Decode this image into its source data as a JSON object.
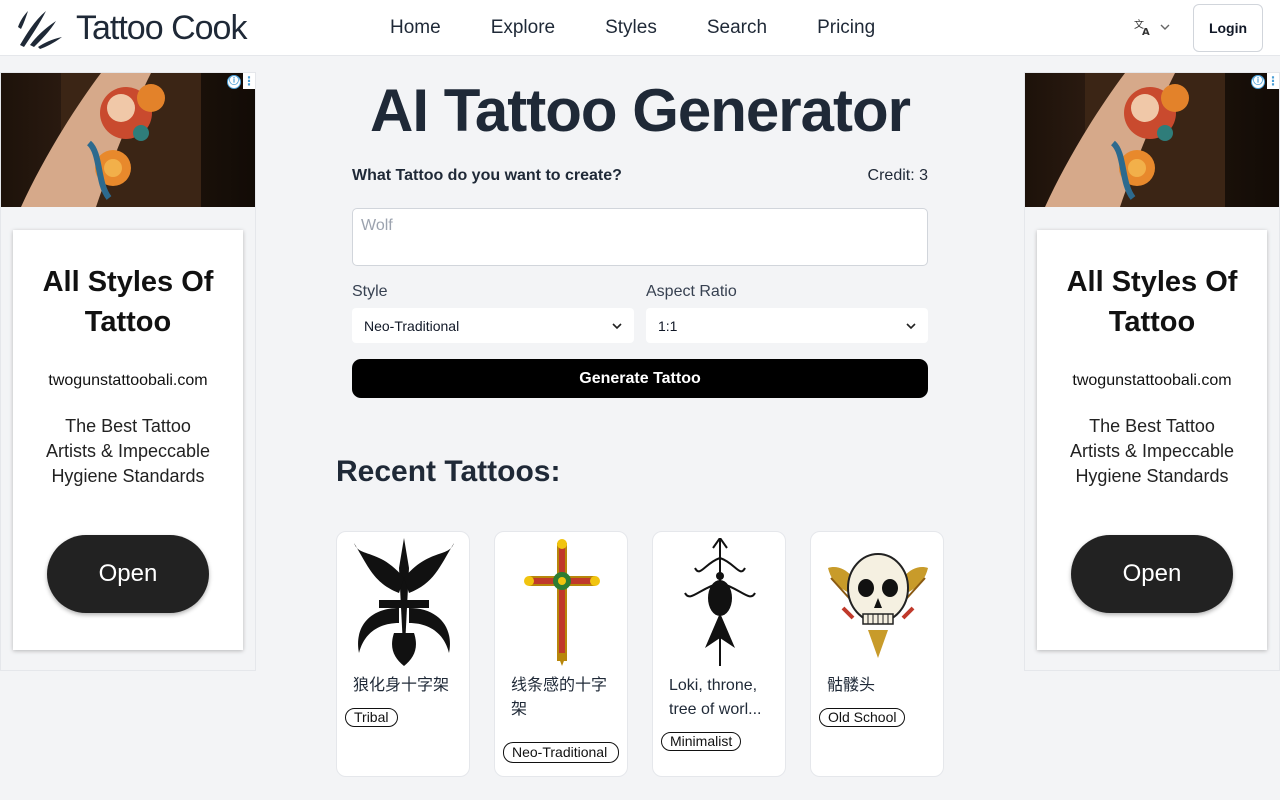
{
  "header": {
    "logo_text": "Tattoo Cook",
    "nav": [
      "Home",
      "Explore",
      "Styles",
      "Search",
      "Pricing"
    ],
    "lang_icon": "translate-icon",
    "login_label": "Login"
  },
  "ad": {
    "title": "All Styles Of Tattoo",
    "domain": "twogunstattoobali.com",
    "description": "The Best Tattoo Artists & Impeccable Hygiene Standards",
    "open_label": "Open",
    "info_icon": "ⓘ",
    "more_icon": "⋮"
  },
  "generator": {
    "title": "AI Tattoo Generator",
    "question": "What Tattoo do you want to create?",
    "credit": "Credit: 3",
    "prompt_placeholder": "Wolf",
    "style_label": "Style",
    "style_value": "Neo-Traditional",
    "aspect_label": "Aspect Ratio",
    "aspect_value": "1:1",
    "generate_label": "Generate Tattoo"
  },
  "recent": {
    "heading": "Recent Tattoos:",
    "items": [
      {
        "caption": "狼化身十字架",
        "tag": "Tribal"
      },
      {
        "caption": "线条感的十字架",
        "tag": "Neo-Traditional"
      },
      {
        "caption": "Loki, throne, tree of worl...",
        "tag": "Minimalist"
      },
      {
        "caption": "骷髅头",
        "tag": "Old School"
      }
    ]
  }
}
